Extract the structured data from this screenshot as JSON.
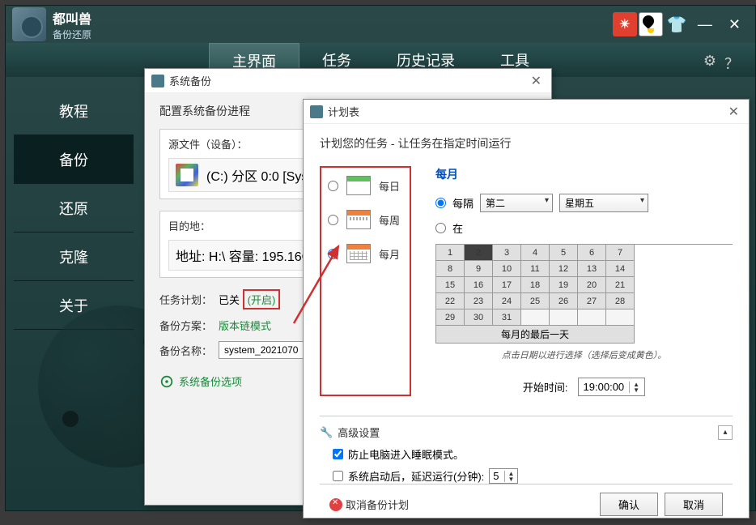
{
  "app": {
    "name": "都叫兽",
    "subtitle": "备份还原"
  },
  "topnav": {
    "items": [
      "主界面",
      "任务",
      "历史记录",
      "工具"
    ],
    "activeIndex": 0
  },
  "sidebar": {
    "items": [
      "教程",
      "备份",
      "还原",
      "克隆",
      "关于"
    ],
    "activeIndex": 1
  },
  "backupDialog": {
    "title": "系统备份",
    "heading": "配置系统备份进程",
    "source": {
      "label": "源文件（设备）：",
      "driveText": "(C:) 分区 0:0 [System]"
    },
    "dest": {
      "label": "目的地：",
      "driveText": "地址: H:\\  容量: 195.16GB"
    },
    "plan": {
      "label": "任务计划：",
      "status": "已关",
      "toggle": "(开启)"
    },
    "scheme": {
      "label": "备份方案：",
      "value": "版本链模式"
    },
    "name": {
      "label": "备份名称：",
      "value": "system_2021070"
    },
    "optionsLink": "系统备份选项"
  },
  "scheduleDialog": {
    "title": "计划表",
    "heading": "计划您的任务 - 让任务在指定时间运行",
    "freq": {
      "daily": "每日",
      "weekly": "每周",
      "monthly": "每月",
      "selected": "monthly"
    },
    "monthly": {
      "title": "每月",
      "every": {
        "label": "每隔",
        "ordinal": "第二",
        "weekday": "星期五"
      },
      "on": {
        "label": "在"
      },
      "days": [
        1,
        2,
        3,
        4,
        5,
        6,
        7,
        8,
        9,
        10,
        11,
        12,
        13,
        14,
        15,
        16,
        17,
        18,
        19,
        20,
        21,
        22,
        23,
        24,
        25,
        26,
        27,
        28,
        29,
        30,
        31
      ],
      "lastDay": "每月的最后一天",
      "hint": "点击日期以进行选择（选择后变成黄色）。"
    },
    "startTime": {
      "label": "开始时间:",
      "value": "19:00:00"
    },
    "advanced": {
      "title": "高级设置",
      "noSleep": "防止电脑进入睡眠模式。",
      "delayStart": "系统启动后，延迟运行(分钟):",
      "delayValue": "5"
    },
    "footer": {
      "cancelPlan": "取消备份计划",
      "ok": "确认",
      "cancel": "取消"
    }
  }
}
